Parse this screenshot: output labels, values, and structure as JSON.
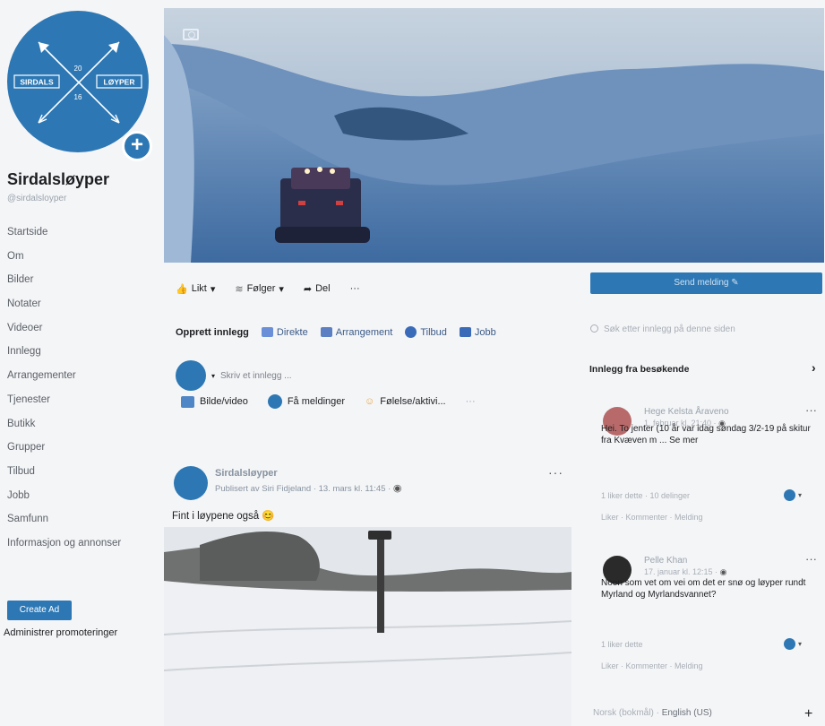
{
  "page": {
    "name": "Sirdalsløyper",
    "handle": "@sirdalsloyper",
    "logo": {
      "text_left": "SIRDALS",
      "text_right": "LØYPER",
      "num_top": "20",
      "num_bottom": "16"
    }
  },
  "nav": {
    "items": [
      "Startside",
      "Om",
      "Bilder",
      "Notater",
      "Videoer",
      "Innlegg",
      "Arrangementer",
      "Tjenester",
      "Butikk",
      "Grupper",
      "Tilbud",
      "Jobb",
      "Samfunn",
      "Informasjon og annonser"
    ],
    "create_ad": "Create Ad",
    "admin_promotions": "Administrer promoteringer"
  },
  "actions": {
    "like": "Likt",
    "following": "Følger",
    "share": "Del",
    "more": "···",
    "send_message": "Send melding"
  },
  "create_post": {
    "title": "Opprett innlegg",
    "options": [
      "Direkte",
      "Arrangement",
      "Tilbud",
      "Jobb"
    ],
    "placeholder": "Skriv et innlegg ...",
    "post_actions": [
      "Bilde/video",
      "Få meldinger",
      "Følelse/aktivi..."
    ],
    "more": "···"
  },
  "post": {
    "author": "Sirdalsløyper",
    "meta": "Publisert av Siri Fidjeland · 13. mars kl. 11:45 ·",
    "text": "Fint i løypene også 😊",
    "dots": "···"
  },
  "right": {
    "search_placeholder": "Søk etter innlegg på denne siden",
    "visitors_title": "Innlegg fra besøkende",
    "visitor_posts": [
      {
        "name": "Hege Kelsta Åraveno",
        "time": "1. februar kl. 21:40 ·",
        "text": "Hei. To jenter (10 år var idag søndag 3/2-19 på skitur fra Kvæven m ... Se mer",
        "stats": "1 liker dette · 10 delinger",
        "actions": "Liker · Kommenter · Melding"
      },
      {
        "name": "Pelle Khan",
        "time": "17. januar kl. 12:15 ·",
        "text": "Noen som vet om vei om det er snø og løyper rundt Myrland og Myrlandsvannet?",
        "stats": "1 liker dette",
        "actions": "Liker · Kommenter · Melding"
      }
    ],
    "language_label": "Norsk (bokmål) ·",
    "language_value": "English (US)",
    "plus": "+"
  },
  "colors": {
    "brand": "#2d78b4",
    "accent_text": "#3a5a88"
  }
}
